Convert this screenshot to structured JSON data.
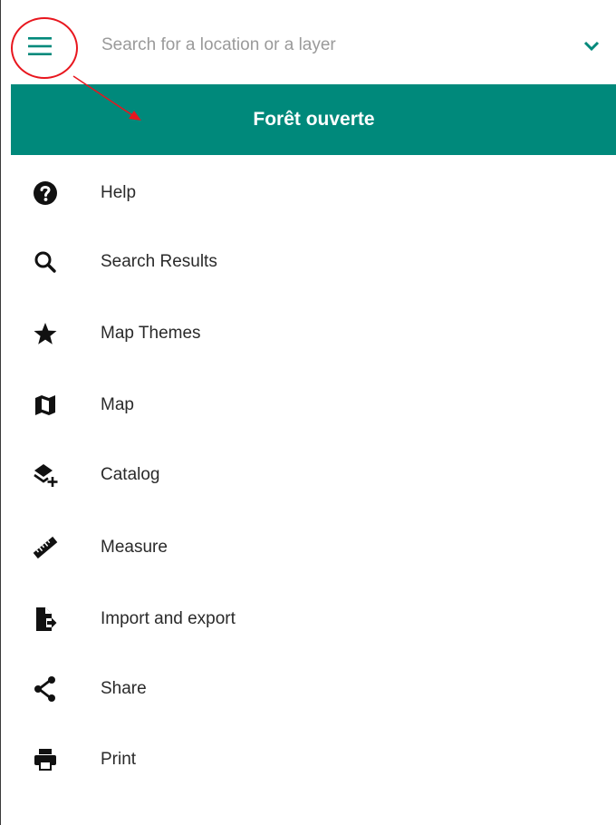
{
  "search": {
    "placeholder": "Search for a location or a layer",
    "value": ""
  },
  "title": "Forêt ouverte",
  "colors": {
    "accent": "#00897b",
    "annotation": "#e8161e",
    "icon": "#111111",
    "text": "#2a2a2a"
  },
  "icons": {
    "menu": "hamburger-icon",
    "expand": "chevron-down-icon"
  },
  "menu": [
    {
      "label": "Help",
      "icon": "help-circle-icon"
    },
    {
      "label": "Search Results",
      "icon": "magnifier-icon"
    },
    {
      "label": "Map Themes",
      "icon": "star-icon"
    },
    {
      "label": "Map",
      "icon": "map-icon"
    },
    {
      "label": "Catalog",
      "icon": "layers-plus-icon"
    },
    {
      "label": "Measure",
      "icon": "ruler-icon"
    },
    {
      "label": "Import and export",
      "icon": "file-export-icon"
    },
    {
      "label": "Share",
      "icon": "share-icon"
    },
    {
      "label": "Print",
      "icon": "printer-icon"
    }
  ]
}
